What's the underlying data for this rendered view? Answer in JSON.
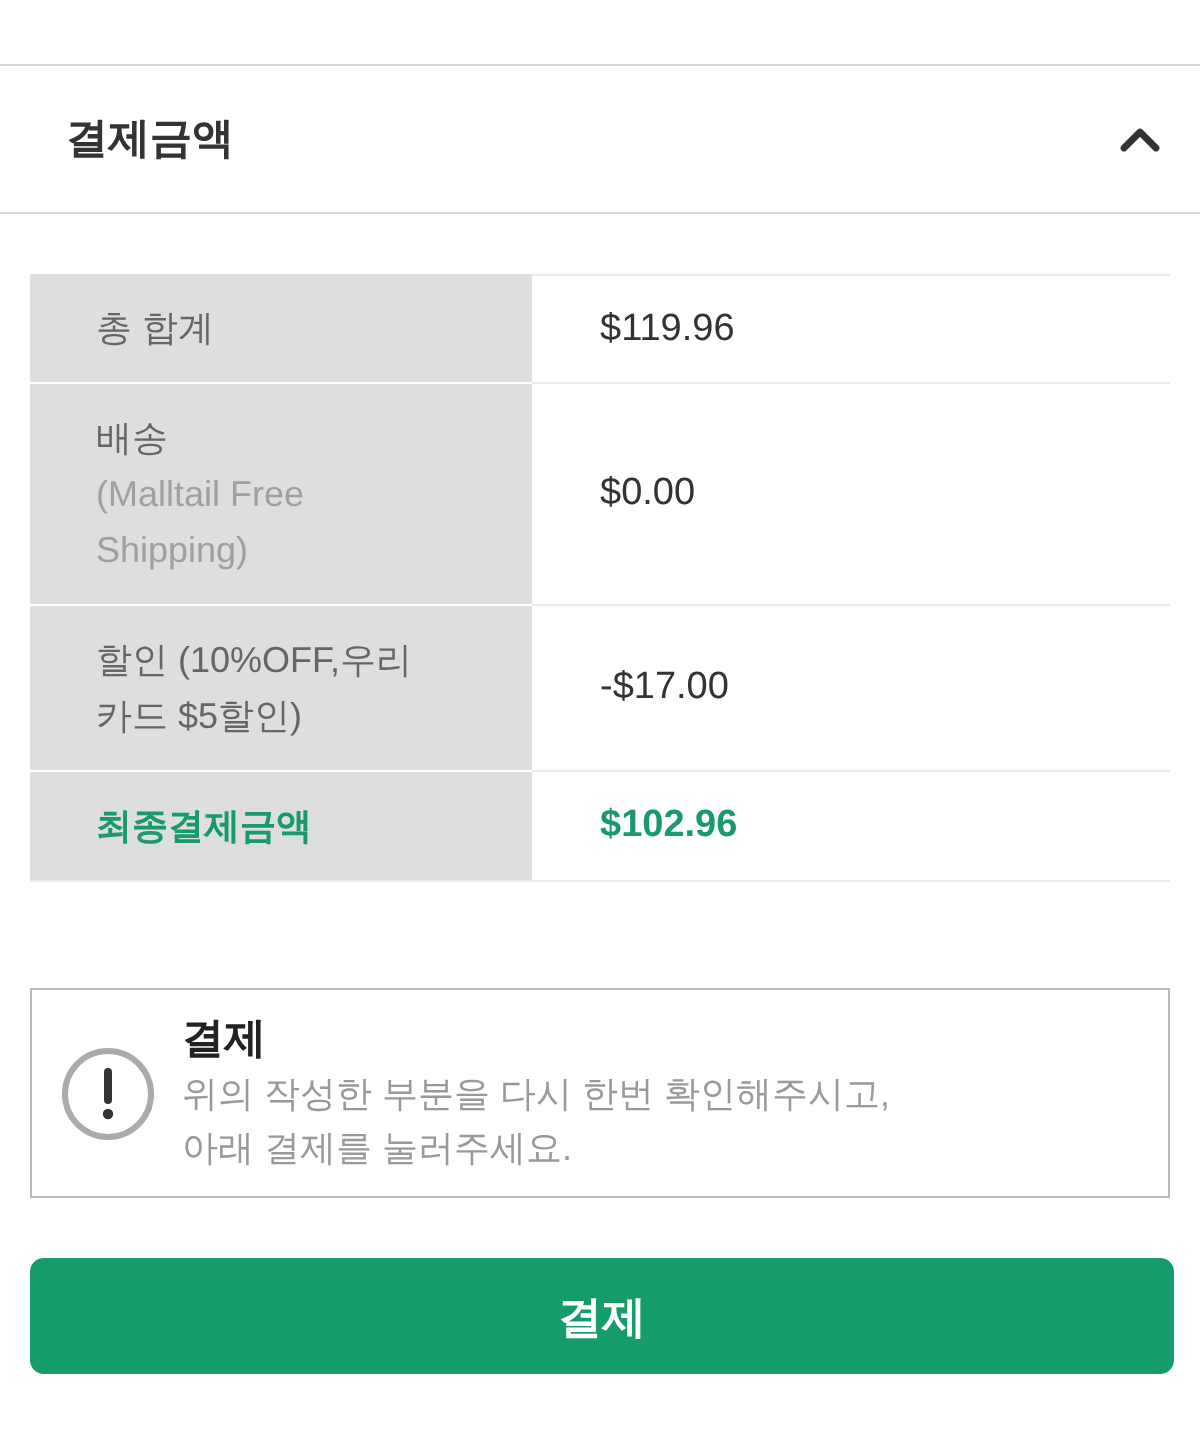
{
  "section": {
    "title": "결제금액",
    "expanded": true
  },
  "summary": {
    "rows": [
      {
        "kind": "normal",
        "label": "총 합계",
        "value": "$119.96"
      },
      {
        "kind": "normal",
        "label": "배송",
        "note": "(Malltail Free Shipping)",
        "value": "$0.00"
      },
      {
        "kind": "normal",
        "label": "할인 (10%OFF,우리 카드 $5할인)",
        "value": "-$17.00"
      },
      {
        "kind": "total",
        "label": "최종결제금액",
        "value": "$102.96"
      }
    ]
  },
  "notice": {
    "title": "결제",
    "message": "위의 작성한 부분을 다시 한번 확인해주시고,\n아래 결제를 눌러주세요."
  },
  "pay_button": {
    "label": "결제"
  }
}
